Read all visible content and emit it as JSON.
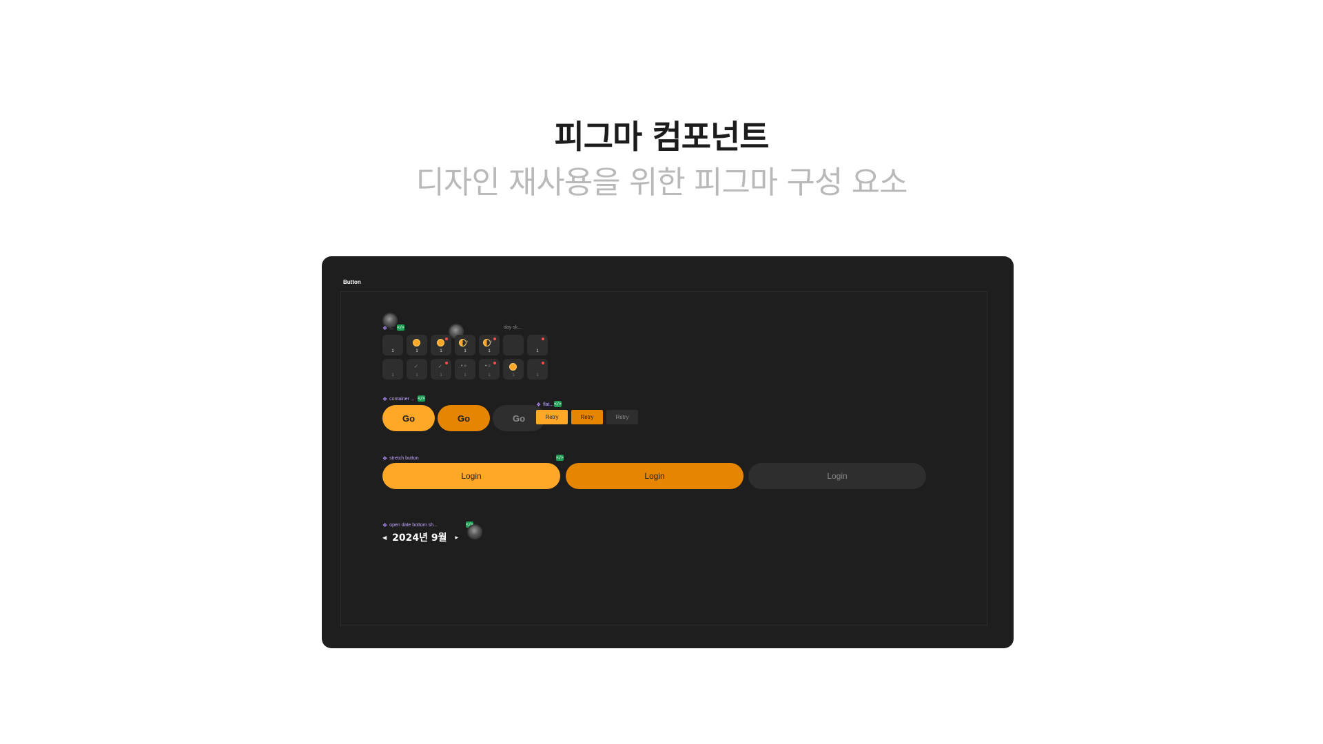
{
  "hero": {
    "title": "피그마 컴포넌트",
    "subtitle": "디자인 재사용을 위한 피그마 구성 요소"
  },
  "canvas": {
    "frame_label": "Button"
  },
  "day_section": {
    "label_main": "...",
    "label_day": "day sk...",
    "rows": [
      [
        {
          "num": "1",
          "icon": "none",
          "badge": false
        },
        {
          "num": "1",
          "icon": "sun",
          "badge": false
        },
        {
          "num": "1",
          "icon": "sun",
          "badge": true
        },
        {
          "num": "1",
          "icon": "half-sun-search",
          "badge": false
        },
        {
          "num": "1",
          "icon": "half-sun-search",
          "badge": true
        },
        {
          "num": "",
          "icon": "none",
          "badge": false
        },
        {
          "num": "1",
          "icon": "none",
          "badge": true
        }
      ],
      [
        {
          "num": "1",
          "icon": "none",
          "badge": false
        },
        {
          "num": "1",
          "icon": "check",
          "badge": false
        },
        {
          "num": "1",
          "icon": "check",
          "badge": true
        },
        {
          "num": "1",
          "icon": "search",
          "badge": false
        },
        {
          "num": "1",
          "icon": "search",
          "badge": true
        },
        {
          "num": "1",
          "icon": "sun",
          "badge": false
        },
        {
          "num": "1",
          "icon": "none",
          "badge": true
        }
      ]
    ]
  },
  "container_section": {
    "label": "container ...",
    "buttons": [
      "Go",
      "Go",
      "Go"
    ]
  },
  "flat_section": {
    "label": "flat...",
    "buttons": [
      "Retry",
      "Retry",
      "Retry"
    ]
  },
  "stretch_section": {
    "label": "stretch button",
    "buttons": [
      "Login",
      "Login",
      "Login"
    ]
  },
  "date_section": {
    "label": "open date bottom sh...",
    "date_text": "2024년 9월",
    "prev_arrow": "◀",
    "next_arrow": "▶"
  },
  "colors": {
    "primary": "#ffa726",
    "pressed": "#e68600",
    "disabled": "#2e2e2e",
    "canvas_bg": "#1e1e1e",
    "label_purple": "#c4a6ff",
    "code_badge": "#1f9d55"
  },
  "icons": {
    "component": "diamond-icon",
    "code": "code-icon",
    "avatar": "avatar-icon"
  }
}
